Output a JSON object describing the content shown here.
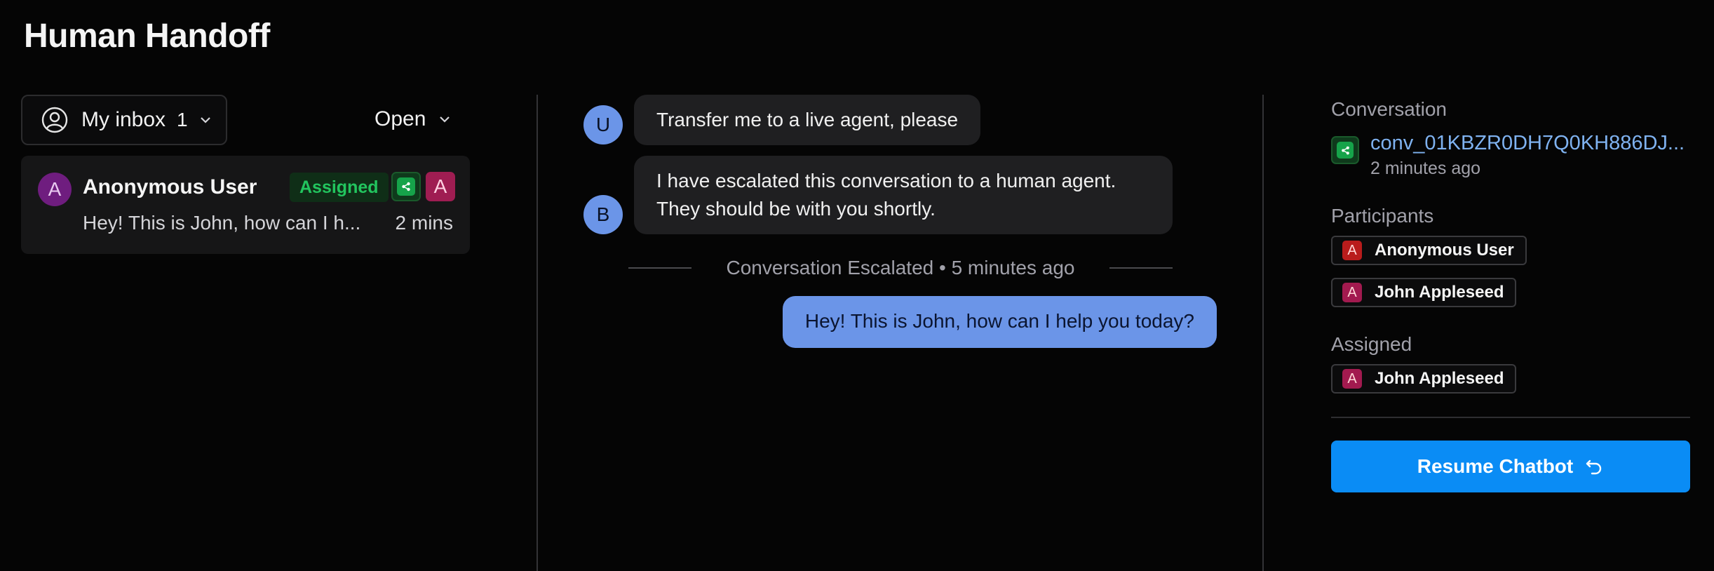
{
  "page": {
    "title": "Human Handoff"
  },
  "inbox": {
    "label": "My inbox",
    "count": "1",
    "status_filter": "Open",
    "conversation": {
      "avatar_letter": "A",
      "name": "Anonymous User",
      "status_badge": "Assigned",
      "assignee_letter": "A",
      "preview": "Hey! This is John, how can I h...",
      "time": "2 mins"
    }
  },
  "chat": {
    "messages": [
      {
        "sender_initial": "U",
        "text": "Transfer me to a live agent, please"
      },
      {
        "sender_initial": "B",
        "lines": [
          "I have escalated this conversation to a human agent.",
          "They should be with you shortly."
        ]
      }
    ],
    "event": "Conversation Escalated • 5 minutes ago",
    "agent_reply": "Hey! This is John, how can I help you today?"
  },
  "details": {
    "conversation_label": "Conversation",
    "conversation_id": "conv_01KBZR0DH7Q0KH886DJ...",
    "conversation_time": "2 minutes ago",
    "participants_label": "Participants",
    "participants": [
      {
        "letter": "A",
        "name": "Anonymous User",
        "color": "#b91c1c"
      },
      {
        "letter": "A",
        "name": "John Appleseed",
        "color": "#a21a4f"
      }
    ],
    "assigned_label": "Assigned",
    "assigned": {
      "letter": "A",
      "name": "John Appleseed"
    },
    "resume_button": "Resume Chatbot"
  },
  "colors": {
    "accent_blue": "#0a8cf5",
    "assigned_green": "#22c55e",
    "agent_bubble": "#6b95e8",
    "link": "#7fb2f0"
  }
}
